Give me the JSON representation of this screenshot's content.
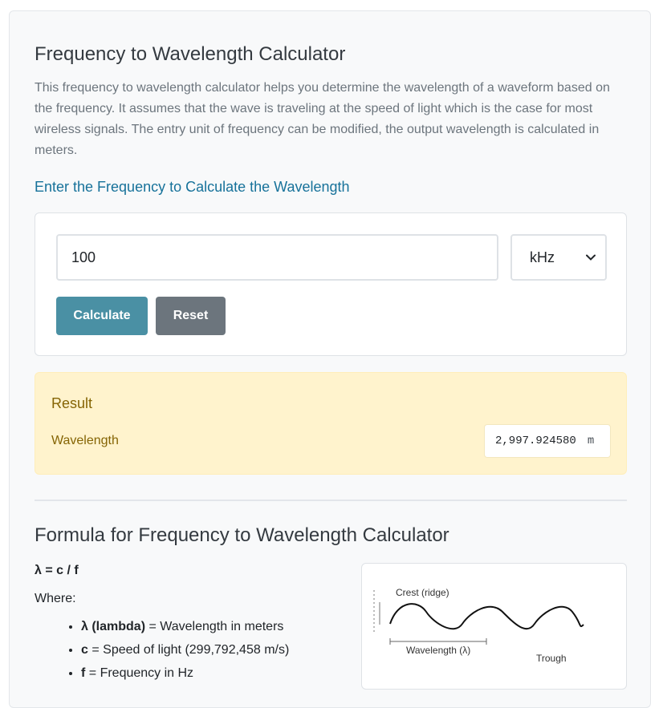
{
  "page": {
    "title": "Frequency to Wavelength Calculator",
    "intro": "This frequency to wavelength calculator helps you determine the wavelength of a waveform based on the frequency. It assumes that the wave is traveling at the speed of light which is the case for most wireless signals. The entry unit of frequency can be modified, the output wavelength is calculated in meters."
  },
  "calculator": {
    "heading": "Enter the Frequency to Calculate the Wavelength",
    "frequency_value": "100",
    "unit_selected": "kHz",
    "unit_icon": "chevron-down-icon",
    "calculate_label": "Calculate",
    "reset_label": "Reset"
  },
  "result": {
    "title": "Result",
    "label": "Wavelength",
    "value": "2,997.924580",
    "unit": "m"
  },
  "formula": {
    "heading": "Formula for Frequency to Wavelength Calculator",
    "equation": "λ = c / f",
    "where": "Where:",
    "variables": [
      {
        "symbol": "λ (lambda)",
        "description": " = Wavelength in meters"
      },
      {
        "symbol": "c",
        "description": " = Speed of light (299,792,458 m/s)"
      },
      {
        "symbol": "f",
        "description": " = Frequency in Hz"
      }
    ]
  },
  "diagram": {
    "crest_label": "Crest (ridge)",
    "wavelength_label": "Wavelength (λ)",
    "trough_label": "Trough"
  },
  "colors": {
    "accent_heading": "#17729a",
    "calculate_button": "#4a90a4",
    "reset_button": "#6c757d",
    "result_background": "#fff3cd",
    "result_text": "#856404"
  }
}
